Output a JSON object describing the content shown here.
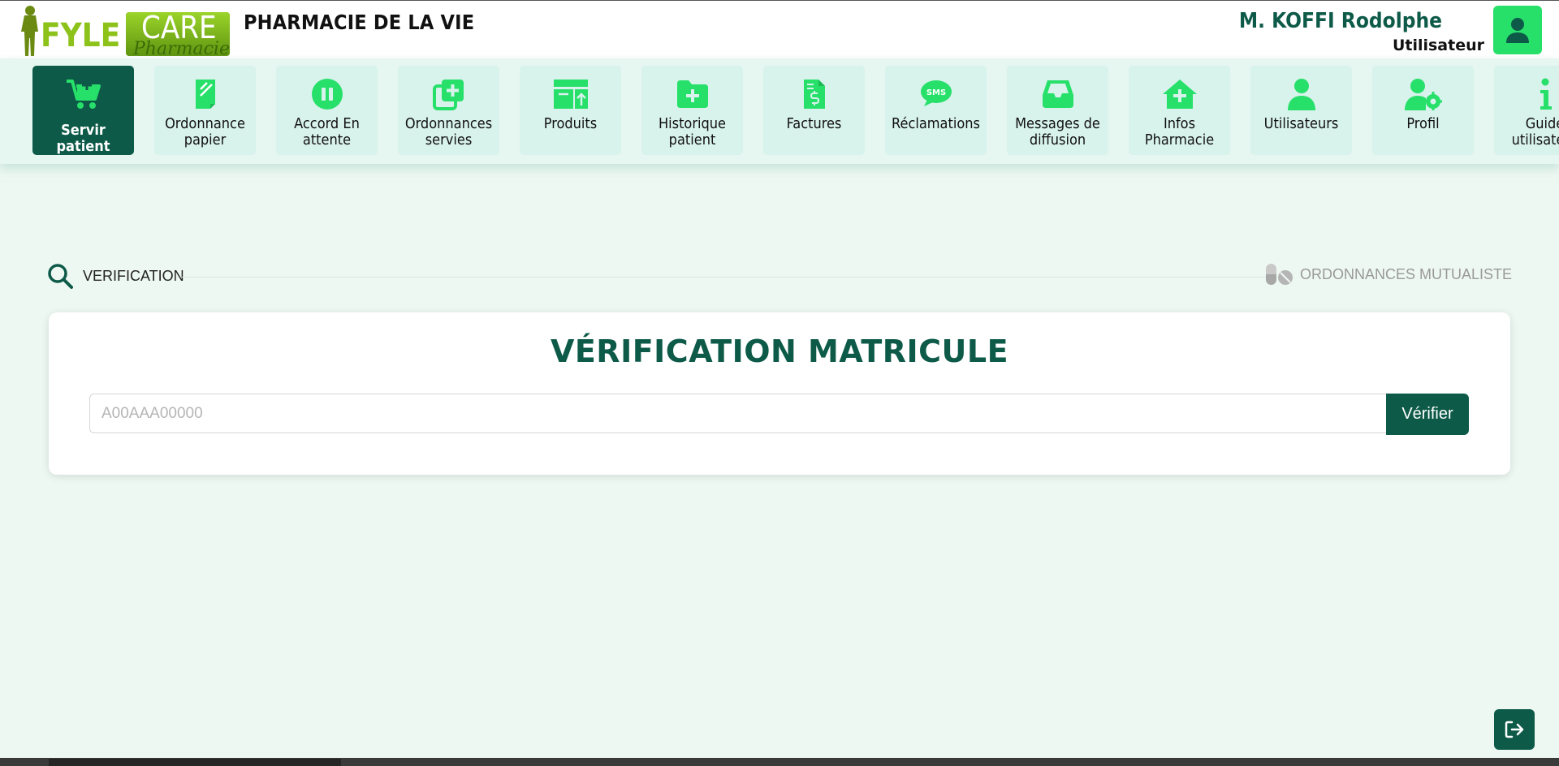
{
  "header": {
    "logo": {
      "word1": "FYLE",
      "word2": "CARE",
      "sub": "Pharmacie"
    },
    "pharmacy_name": "PHARMACIE DE LA VIE",
    "user_name": "M. KOFFI Rodolphe",
    "user_role": "Utilisateur"
  },
  "nav": {
    "items": [
      {
        "label": "Servir patient",
        "icon": "cart-plus-icon",
        "active": true
      },
      {
        "label": "Ordonnance\npapier",
        "icon": "paper-prescription-icon"
      },
      {
        "label": "Accord En\nattente",
        "icon": "pause-icon"
      },
      {
        "label": "Ordonnances\nservies",
        "icon": "copy-plus-icon"
      },
      {
        "label": "Produits",
        "icon": "boxes-icon"
      },
      {
        "label": "Historique\npatient",
        "icon": "folder-plus-icon"
      },
      {
        "label": "Factures",
        "icon": "invoice-icon"
      },
      {
        "label": "Réclamations",
        "icon": "sms-bubble-icon"
      },
      {
        "label": "Messages de\ndiffusion",
        "icon": "inbox-icon"
      },
      {
        "label": "Infos Pharmacie",
        "icon": "house-medical-icon"
      },
      {
        "label": "Utilisateurs",
        "icon": "user-icon"
      },
      {
        "label": "Profil",
        "icon": "user-gear-icon"
      },
      {
        "label": "Guide\nutilisateur",
        "icon": "info-icon"
      }
    ]
  },
  "section": {
    "left_label": "VERIFICATION",
    "right_label": "ORDONNANCES MUTUALISTE"
  },
  "verification": {
    "title": "VÉRIFICATION MATRICULE",
    "input_value": "",
    "input_placeholder": "A00AAA00000",
    "button_label": "Vérifier"
  },
  "colors": {
    "primary_dark": "#0d5a48",
    "accent_green": "#26e06a",
    "nav_bg": "#d8f2ec",
    "page_bg": "#eef8f2"
  }
}
